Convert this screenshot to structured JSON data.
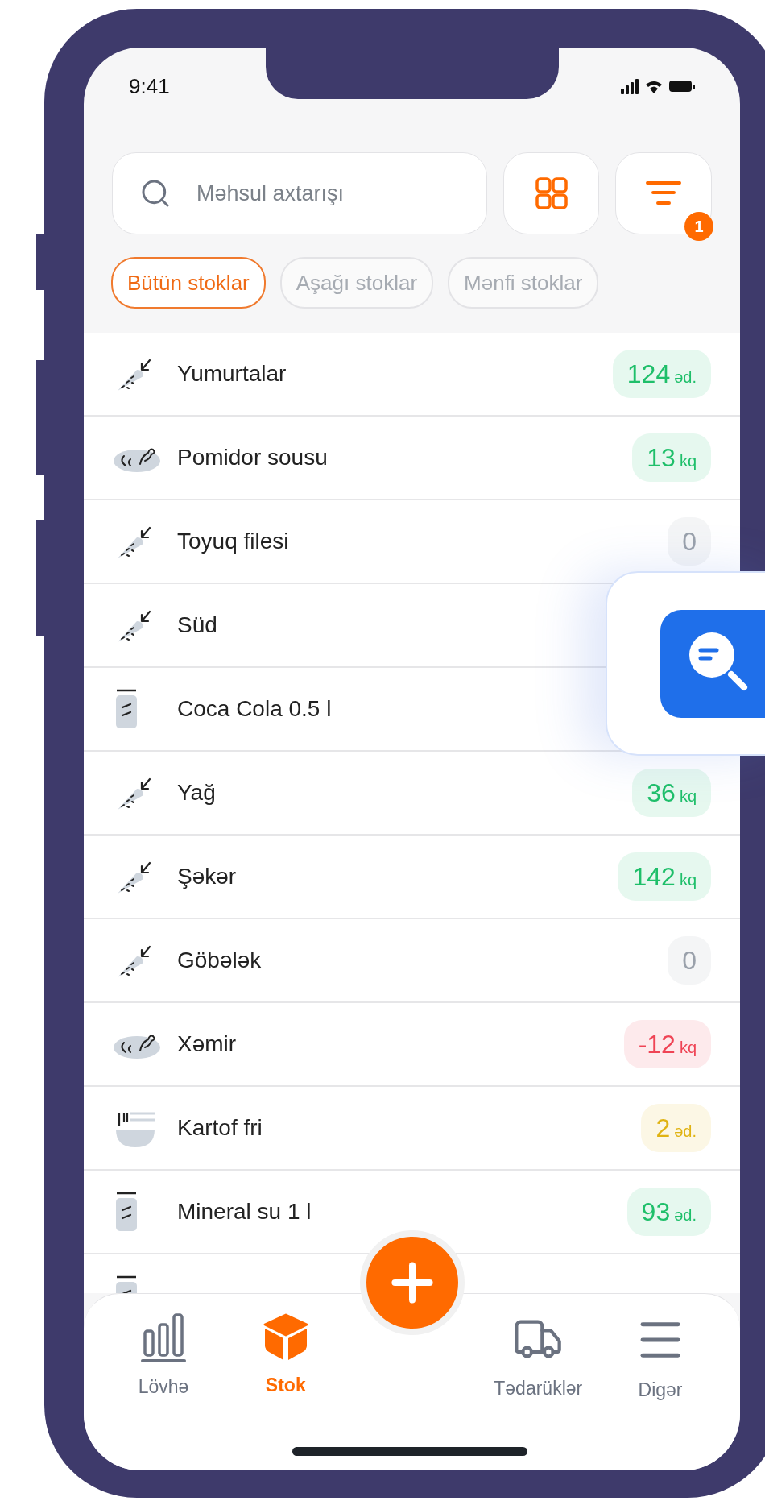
{
  "status_bar": {
    "time": "9:41"
  },
  "search": {
    "placeholder": "Məhsul axtarışı"
  },
  "filter": {
    "badge": "1"
  },
  "chips": [
    {
      "label": "Bütün stoklar",
      "selected": true
    },
    {
      "label": "Aşağı stoklar",
      "selected": false
    },
    {
      "label": "Mənfi stoklar",
      "selected": false
    }
  ],
  "items": [
    {
      "name": "Yumurtalar",
      "kind": "carrot",
      "quantity": "124",
      "unit": "əd.",
      "color": "#1fbf6a"
    },
    {
      "name": "Pomidor sousu",
      "kind": "meat",
      "quantity": "13",
      "unit": "kq",
      "color": "#1fbf6a"
    },
    {
      "name": "Toyuq filesi",
      "kind": "carrot",
      "quantity": "0",
      "color": "#9aa1ab"
    },
    {
      "name": "Süd",
      "kind": "carrot"
    },
    {
      "name": "Coca Cola 0.5 l",
      "kind": "can"
    },
    {
      "name": "Yağ",
      "kind": "carrot",
      "quantity": "36",
      "unit": "kq",
      "color": "#1fbf6a"
    },
    {
      "name": "Şəkər",
      "kind": "carrot",
      "quantity": "142",
      "unit": "kq",
      "color": "#1fbf6a"
    },
    {
      "name": "Göbələk",
      "kind": "carrot",
      "quantity": "0",
      "color": "#9aa1ab"
    },
    {
      "name": "Xəmir",
      "kind": "meat",
      "quantity": "-12",
      "unit": "kq",
      "color": "#ef4455"
    },
    {
      "name": "Kartof fri",
      "kind": "bowl",
      "quantity": "2",
      "unit": "əd.",
      "color": "#e0b313"
    },
    {
      "name": "Mineral su 1 l",
      "kind": "can",
      "quantity": "93",
      "unit": "əd.",
      "color": "#1fbf6a"
    },
    {
      "kind": "can"
    }
  ],
  "nav": [
    {
      "label": "Lövhə",
      "kind": "chart",
      "selected": false
    },
    {
      "label": "Stok",
      "kind": "box",
      "selected": true
    },
    {
      "label": "Tədarüklər",
      "kind": "truck",
      "selected": false
    },
    {
      "label": "Digər",
      "kind": "menu",
      "selected": false
    }
  ]
}
